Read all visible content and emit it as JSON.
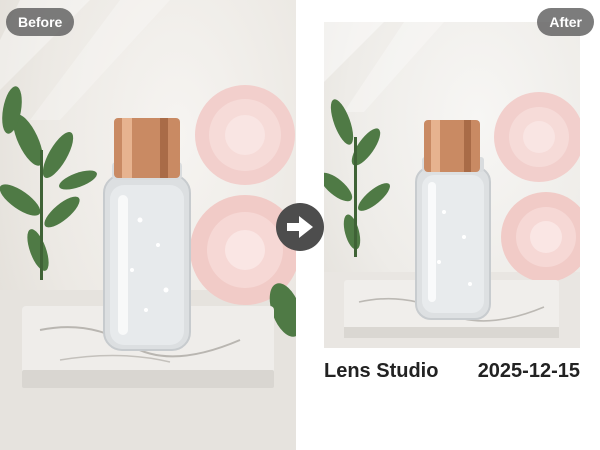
{
  "comparison": {
    "before_label": "Before",
    "after_label": "After"
  },
  "caption": {
    "brand": "Lens Studio",
    "date": "2025-12-15"
  },
  "icons": {
    "compare_arrow": "arrow-right-icon"
  },
  "colors": {
    "badge_bg": "#5f5f5f",
    "arrow_bg": "#4d4d4d",
    "cap_copper": "#c98a63",
    "peony": "#f4d0cd",
    "leaf": "#4f7a45"
  }
}
